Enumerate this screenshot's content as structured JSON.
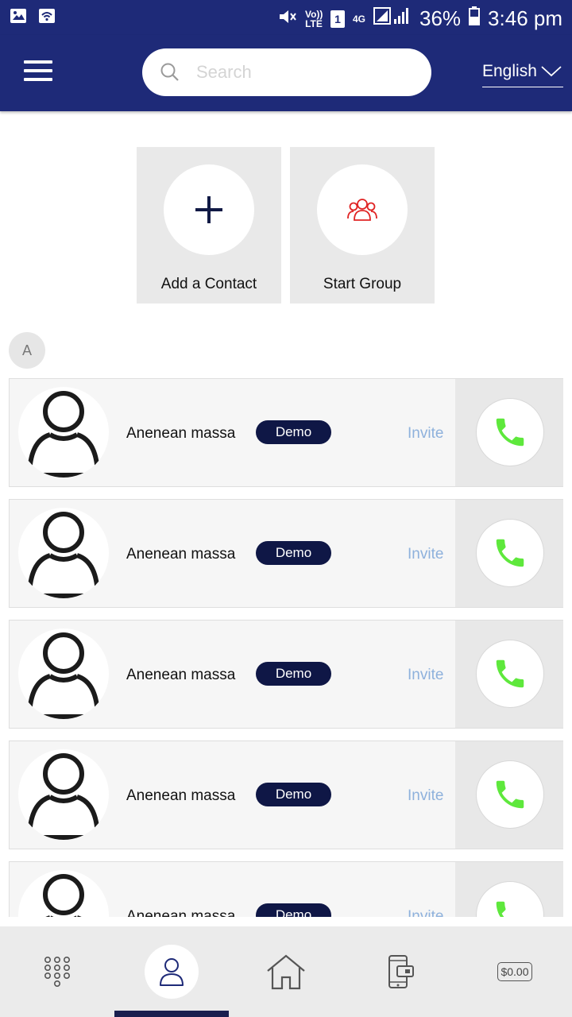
{
  "status_bar": {
    "volte_label": "Vo)) LTE",
    "sim_label": "1",
    "network_label": "4G",
    "battery": "36%",
    "time": "3:46 pm"
  },
  "header": {
    "search_placeholder": "Search",
    "language": "English"
  },
  "actions": {
    "add_contact": "Add a Contact",
    "start_group": "Start Group"
  },
  "section_letter": "A",
  "contacts": [
    {
      "name": "Anenean massa",
      "badge": "Demo",
      "invite": "Invite"
    },
    {
      "name": "Anenean massa",
      "badge": "Demo",
      "invite": "Invite"
    },
    {
      "name": "Anenean massa",
      "badge": "Demo",
      "invite": "Invite"
    },
    {
      "name": "Anenean massa",
      "badge": "Demo",
      "invite": "Invite"
    },
    {
      "name": "Anenean massa",
      "badge": "Demo",
      "invite": "Invite"
    }
  ],
  "bottom_nav": {
    "items": [
      "dialpad-icon",
      "contacts-icon",
      "home-icon",
      "wallet-icon",
      "balance"
    ],
    "active": "contacts-icon",
    "balance": "$0.00"
  },
  "colors": {
    "header": "#1e2a78",
    "badge": "#0f1746",
    "invite": "#8eb1dc",
    "call_icon": "#5ee83c",
    "group_icon": "#e02424"
  }
}
